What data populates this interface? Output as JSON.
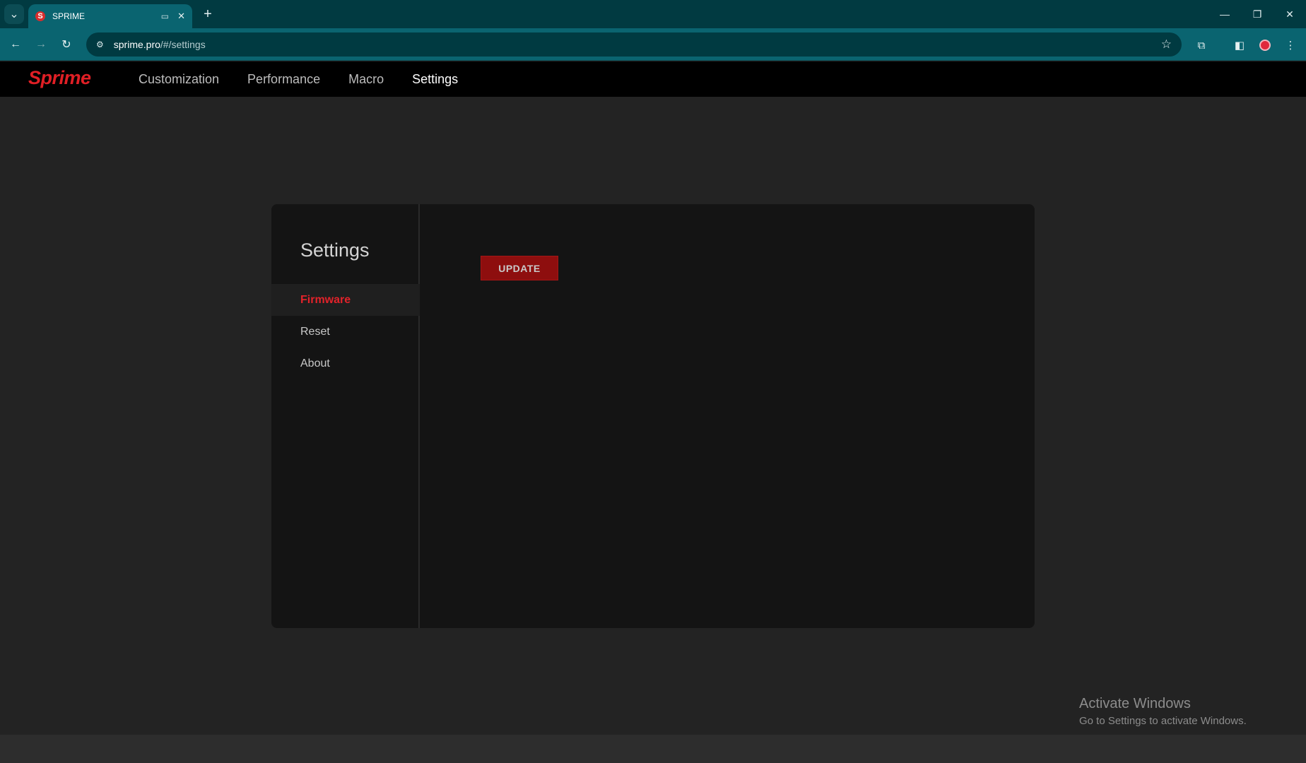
{
  "browser": {
    "tab_title": "SPRIME",
    "tab_favicon": "S",
    "url_host": "sprime.pro",
    "url_path": "/#/settings"
  },
  "app": {
    "logo": "Sprime",
    "nav": [
      {
        "label": "Customization"
      },
      {
        "label": "Performance"
      },
      {
        "label": "Macro"
      },
      {
        "label": "Settings"
      }
    ]
  },
  "settings": {
    "title": "Settings",
    "menu": [
      {
        "label": "Firmware"
      },
      {
        "label": "Reset"
      },
      {
        "label": "About"
      }
    ],
    "update_label": "UPDATE"
  },
  "watermark": {
    "line1": "Activate Windows",
    "line2": "Go to Settings to activate Windows."
  },
  "colors": {
    "accent": "#e01f25",
    "tab_active": "#0a6470",
    "header_bg": "#000000",
    "panel_bg": "#141414"
  }
}
